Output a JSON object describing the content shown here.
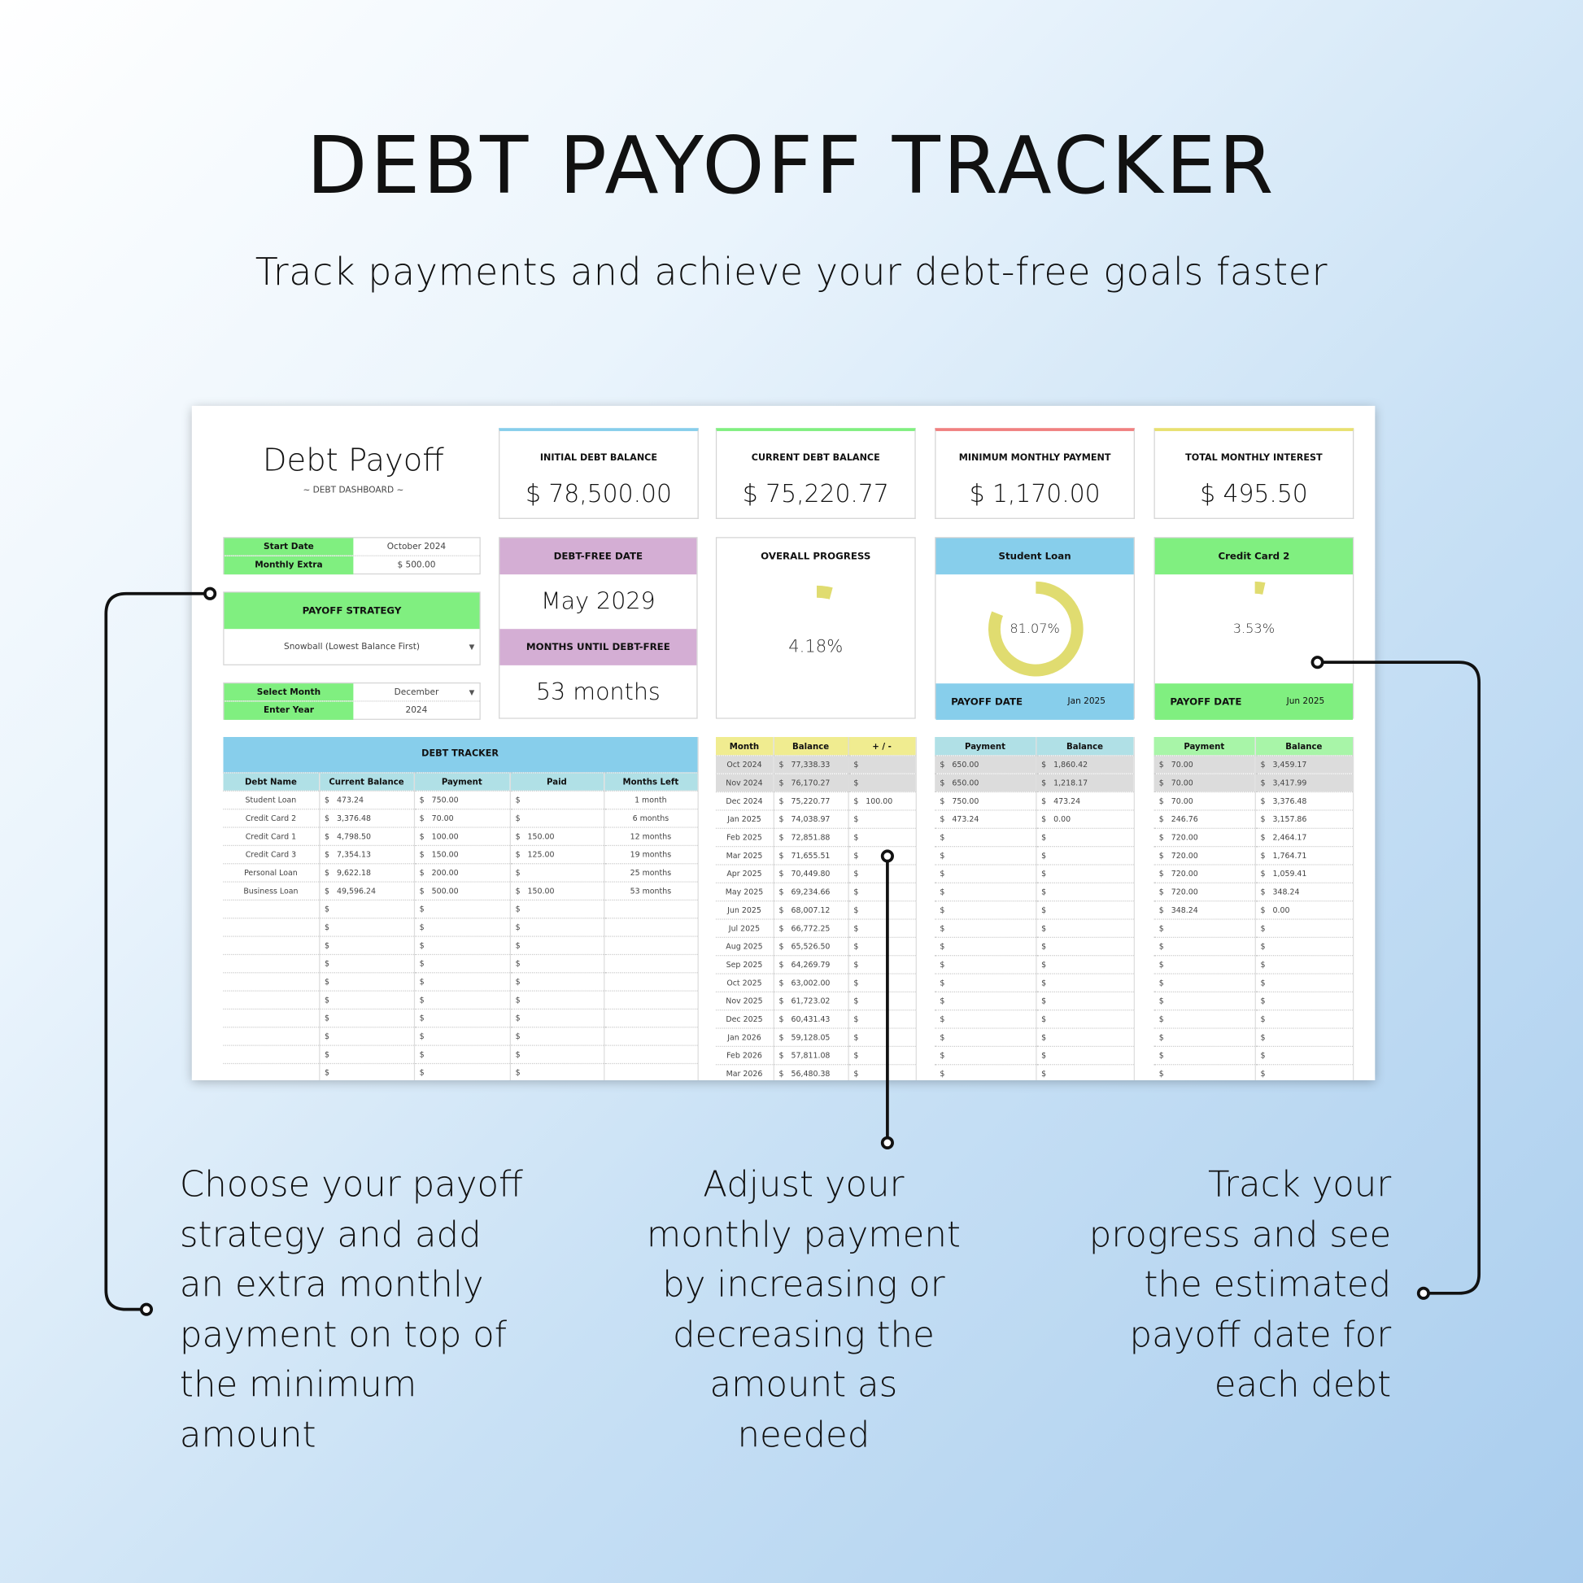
{
  "hero": {
    "title": "DEBT PAYOFF TRACKER",
    "subtitle": "Track payments and achieve your debt-free goals faster"
  },
  "dashboard": {
    "title": "Debt Payoff",
    "subtitle": "~ DEBT DASHBOARD ~",
    "settings": {
      "start_date_label": "Start Date",
      "start_date": "October 2024",
      "monthly_extra_label": "Monthly Extra",
      "monthly_extra": "$  500.00"
    },
    "strategy": {
      "label": "PAYOFF STRATEGY",
      "value": "Snowball (Lowest Balance First)"
    },
    "period": {
      "month_label": "Select Month",
      "month": "December",
      "year_label": "Enter Year",
      "year": "2024"
    },
    "kpis": [
      {
        "label": "INITIAL DEBT BALANCE",
        "value": "$ 78,500.00",
        "color": "#87ceeb"
      },
      {
        "label": "CURRENT DEBT BALANCE",
        "value": "$ 75,220.77",
        "color": "#80ef80"
      },
      {
        "label": "MINIMUM MONTHLY PAYMENT",
        "value": "$ 1,170.00",
        "color": "#f08080"
      },
      {
        "label": "TOTAL MONTHLY INTEREST",
        "value": "$ 495.50",
        "color": "#e8e070"
      }
    ],
    "debt_free": {
      "date_label": "DEBT-FREE DATE",
      "date": "May 2029",
      "months_label": "MONTHS UNTIL DEBT-FREE",
      "months": "53 months",
      "color": "#d4aed4"
    },
    "overall": {
      "label": "OVERALL PROGRESS",
      "percent_text": "4.18%",
      "percent": 4.18
    },
    "debt_cards": [
      {
        "name": "Student Loan",
        "percent_text": "81.07%",
        "percent": 81.07,
        "payoff_label": "PAYOFF DATE",
        "payoff_date": "Jan 2025",
        "color": "#87ceeb"
      },
      {
        "name": "Credit Card 2",
        "percent_text": "3.53%",
        "percent": 3.53,
        "payoff_label": "PAYOFF DATE",
        "payoff_date": "Jun 2025",
        "color": "#80ef80"
      }
    ],
    "ring_color": "#e0dc70",
    "tracker": {
      "title": "DEBT TRACKER",
      "headers": [
        "Debt Name",
        "Current Balance",
        "Payment",
        "Paid",
        "Months Left"
      ],
      "rows": [
        [
          "Student Loan",
          "473.24",
          "750.00",
          "",
          "1 month"
        ],
        [
          "Credit Card 2",
          "3,376.48",
          "70.00",
          "",
          "6 months"
        ],
        [
          "Credit Card 1",
          "4,798.50",
          "100.00",
          "150.00",
          "12 months"
        ],
        [
          "Credit Card 3",
          "7,354.13",
          "150.00",
          "125.00",
          "19 months"
        ],
        [
          "Personal Loan",
          "9,622.18",
          "200.00",
          "",
          "25 months"
        ],
        [
          "Business Loan",
          "49,596.24",
          "500.00",
          "150.00",
          "53 months"
        ]
      ],
      "blank_rows": 10
    },
    "schedule": {
      "headers": [
        "Month",
        "Balance",
        "+ / -"
      ],
      "rows": [
        [
          "Oct 2024",
          "77,338.33",
          ""
        ],
        [
          "Nov 2024",
          "76,170.27",
          ""
        ],
        [
          "Dec 2024",
          "75,220.77",
          "100.00"
        ],
        [
          "Jan 2025",
          "74,038.97",
          ""
        ],
        [
          "Feb 2025",
          "72,851.88",
          ""
        ],
        [
          "Mar 2025",
          "71,655.51",
          ""
        ],
        [
          "Apr 2025",
          "70,449.80",
          ""
        ],
        [
          "May 2025",
          "69,234.66",
          ""
        ],
        [
          "Jun 2025",
          "68,007.12",
          ""
        ],
        [
          "Jul 2025",
          "66,772.25",
          ""
        ],
        [
          "Aug 2025",
          "65,526.50",
          ""
        ],
        [
          "Sep 2025",
          "64,269.79",
          ""
        ],
        [
          "Oct 2025",
          "63,002.00",
          ""
        ],
        [
          "Nov 2025",
          "61,723.02",
          ""
        ],
        [
          "Dec 2025",
          "60,431.43",
          ""
        ],
        [
          "Jan 2026",
          "59,128.05",
          ""
        ],
        [
          "Feb 2026",
          "57,811.08",
          ""
        ],
        [
          "Mar 2026",
          "56,480.38",
          ""
        ]
      ]
    },
    "student_schedule": {
      "headers": [
        "Payment",
        "Balance"
      ],
      "rows": [
        [
          "650.00",
          "1,860.42"
        ],
        [
          "650.00",
          "1,218.17"
        ],
        [
          "750.00",
          "473.24"
        ],
        [
          "473.24",
          "0.00"
        ]
      ],
      "blank_rows": 14
    },
    "cc2_schedule": {
      "headers": [
        "Payment",
        "Balance"
      ],
      "rows": [
        [
          "70.00",
          "3,459.17"
        ],
        [
          "70.00",
          "3,417.99"
        ],
        [
          "70.00",
          "3,376.48"
        ],
        [
          "246.76",
          "3,157.86"
        ],
        [
          "720.00",
          "2,464.17"
        ],
        [
          "720.00",
          "1,764.71"
        ],
        [
          "720.00",
          "1,059.41"
        ],
        [
          "720.00",
          "348.24"
        ],
        [
          "348.24",
          "0.00"
        ]
      ],
      "blank_rows": 9
    },
    "currency": "$"
  },
  "callouts": {
    "left": [
      "Choose your payoff",
      "strategy and add",
      "an extra monthly",
      "payment on top of",
      "the minimum",
      "amount"
    ],
    "middle": [
      "Adjust your",
      "monthly payment",
      "by increasing or",
      "decreasing the",
      "amount as",
      "needed"
    ],
    "right": [
      "Track your",
      "progress and see",
      "the estimated",
      "payoff date for",
      "each debt"
    ]
  }
}
